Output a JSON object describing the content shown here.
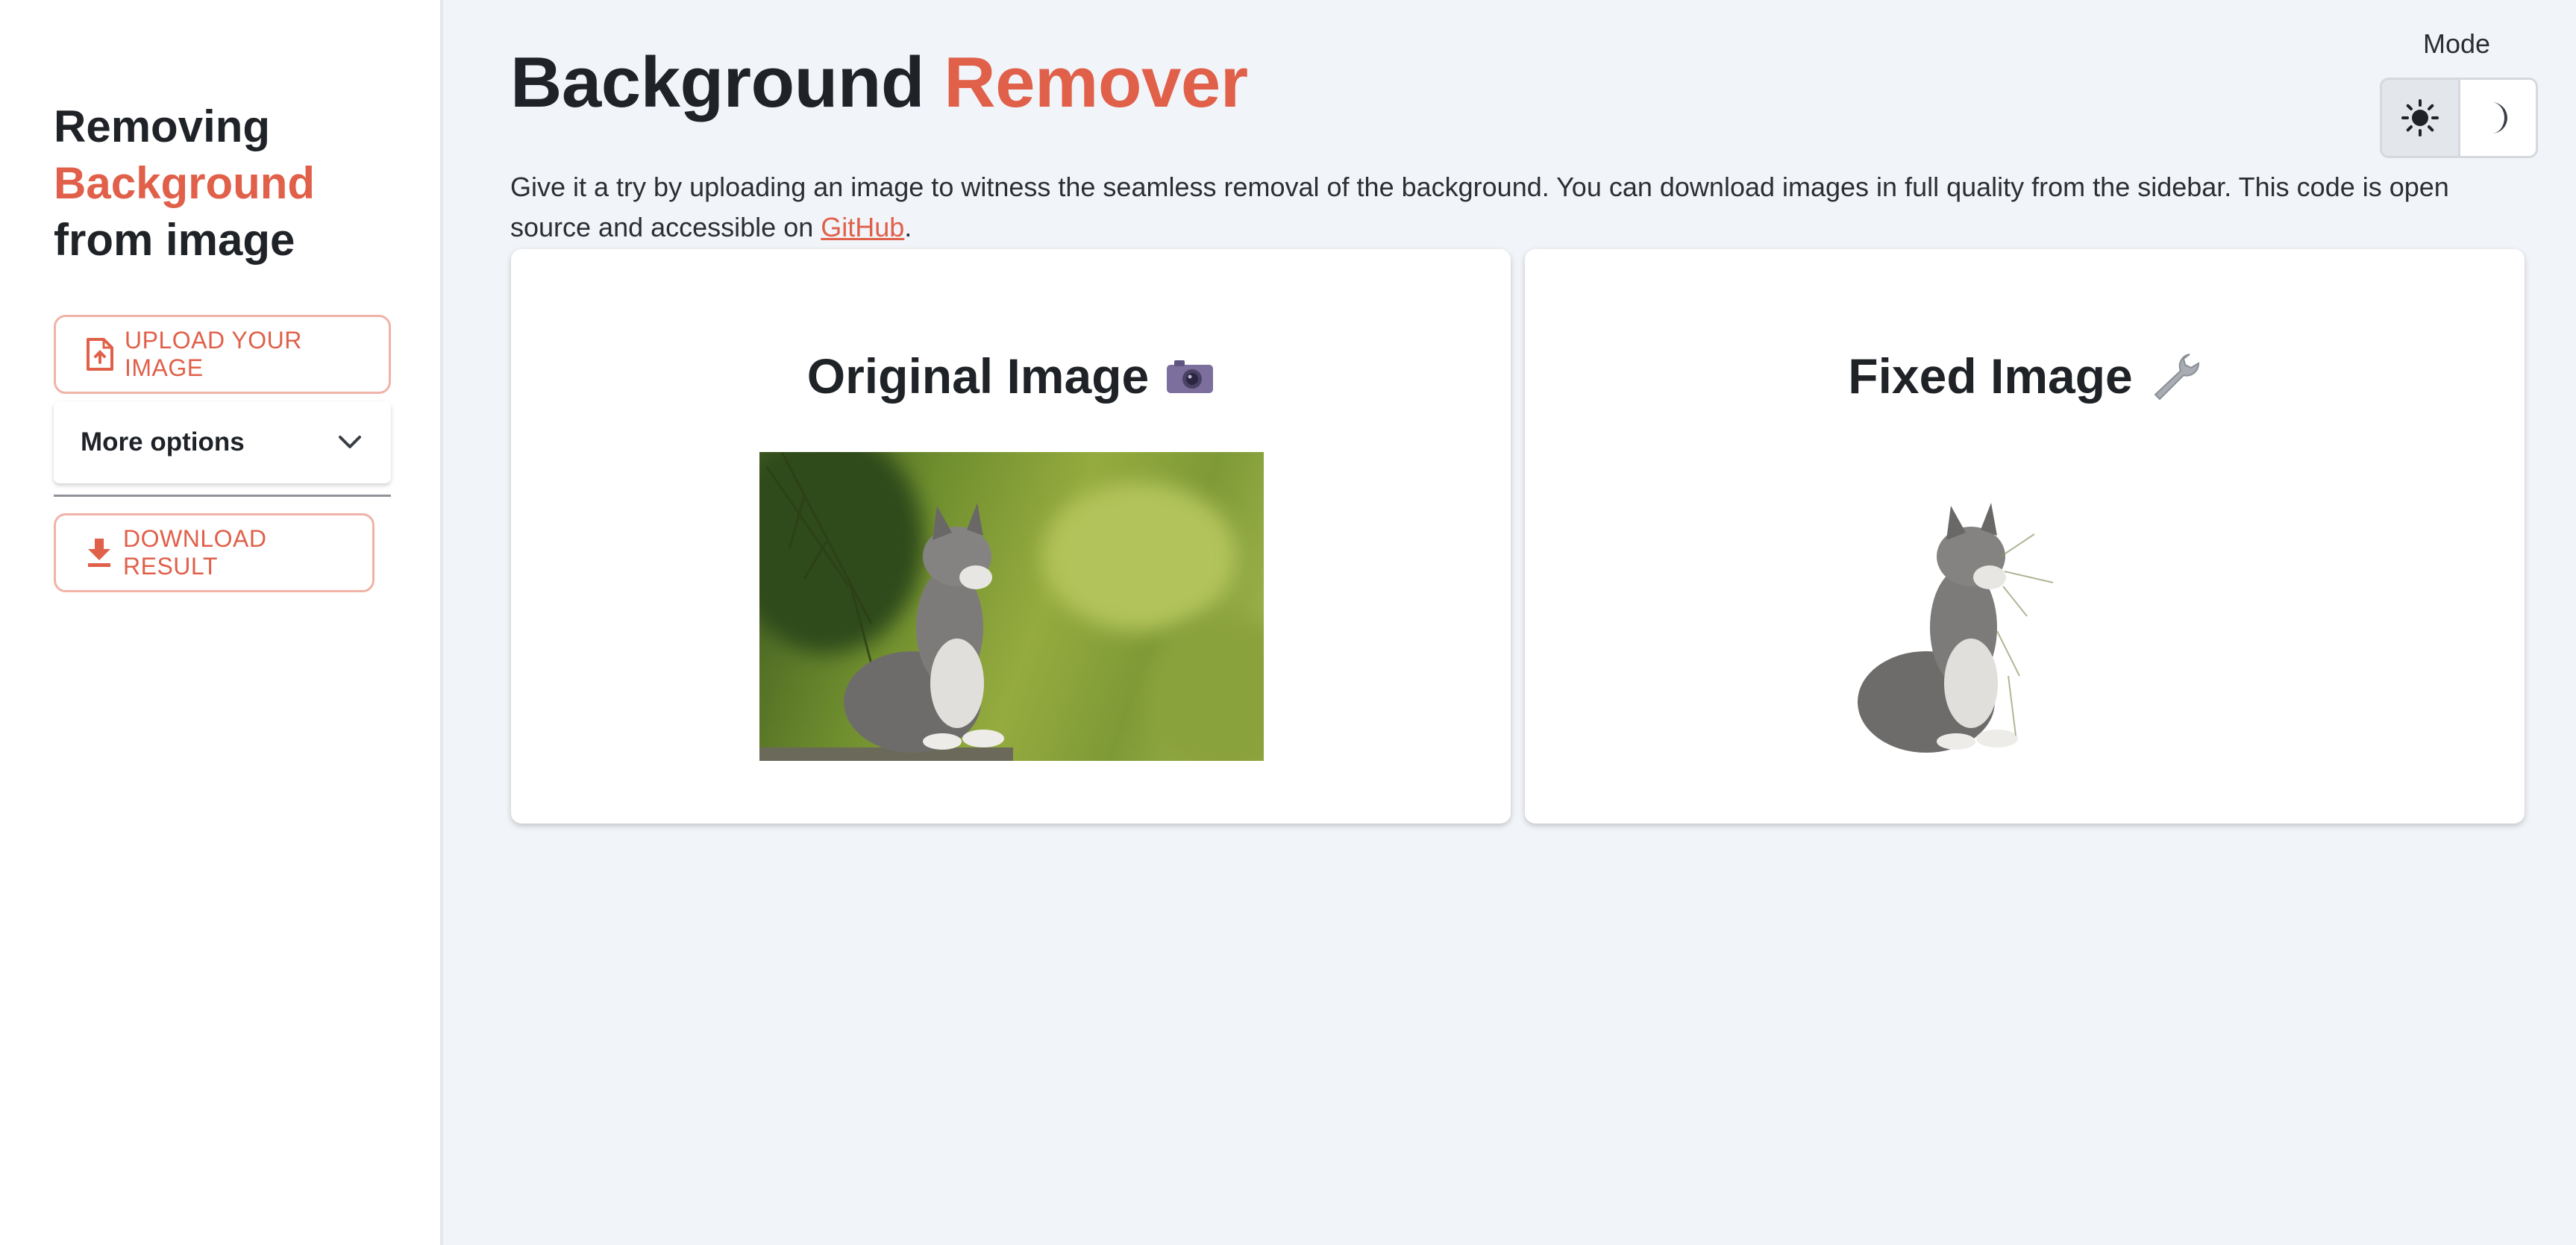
{
  "sidebar": {
    "title_line1": "Removing",
    "title_line2": "Background",
    "title_line3": "from image",
    "upload_label": "UPLOAD YOUR IMAGE",
    "more_options_label": "More options",
    "download_label": "DOWNLOAD RESULT"
  },
  "header": {
    "title_part1": "Background",
    "title_part2": "Remover",
    "description": "Give it a try by uploading an image to witness the seamless removal of the background. You can download images in full quality from the sidebar. This code is open source and accessible on ",
    "link_text": "GitHub",
    "description_end": "."
  },
  "mode": {
    "label": "Mode",
    "options": [
      "sun-icon",
      "moon-icon"
    ],
    "selected": "light"
  },
  "cards": {
    "original_title": "Original Image",
    "original_emoji": "camera-icon",
    "fixed_title": "Fixed Image",
    "fixed_emoji": "wrench-icon"
  },
  "colors": {
    "accent": "#e0604a",
    "background": "#f1f4f8",
    "sidebar": "#ffffff"
  }
}
